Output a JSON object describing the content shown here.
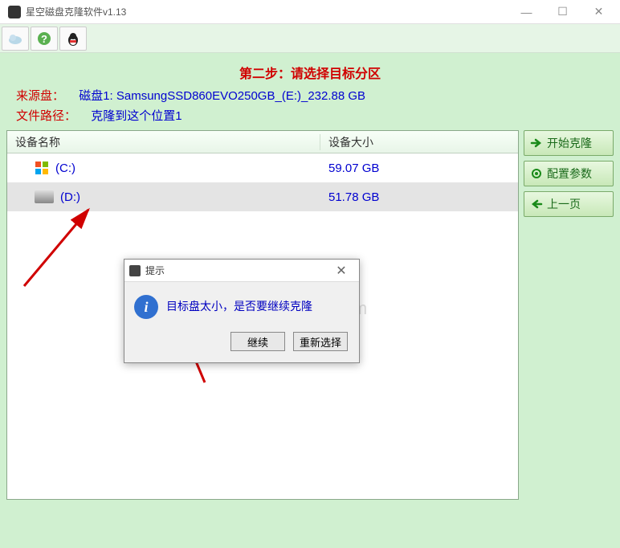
{
  "window": {
    "title": "星空磁盘克隆软件v1.13"
  },
  "step": {
    "title": "第二步：请选择目标分区"
  },
  "source": {
    "label": "来源盘：",
    "value": "磁盘1: SamsungSSD860EVO250GB_(E:)_232.88 GB"
  },
  "path": {
    "label": "文件路径：",
    "value": "克隆到这个位置1"
  },
  "table": {
    "headers": {
      "name": "设备名称",
      "size": "设备大小"
    },
    "rows": [
      {
        "name": "(C:)",
        "size": "59.07 GB",
        "selected": false
      },
      {
        "name": "(D:)",
        "size": "51.78 GB",
        "selected": true
      }
    ]
  },
  "buttons": {
    "start": "开始克隆",
    "config": "配置参数",
    "back": "上一页"
  },
  "dialog": {
    "title": "提示",
    "message": "目标盘太小，是否要继续克隆",
    "continue": "继续",
    "reselect": "重新选择"
  },
  "watermark": "安下载 anxz.com"
}
